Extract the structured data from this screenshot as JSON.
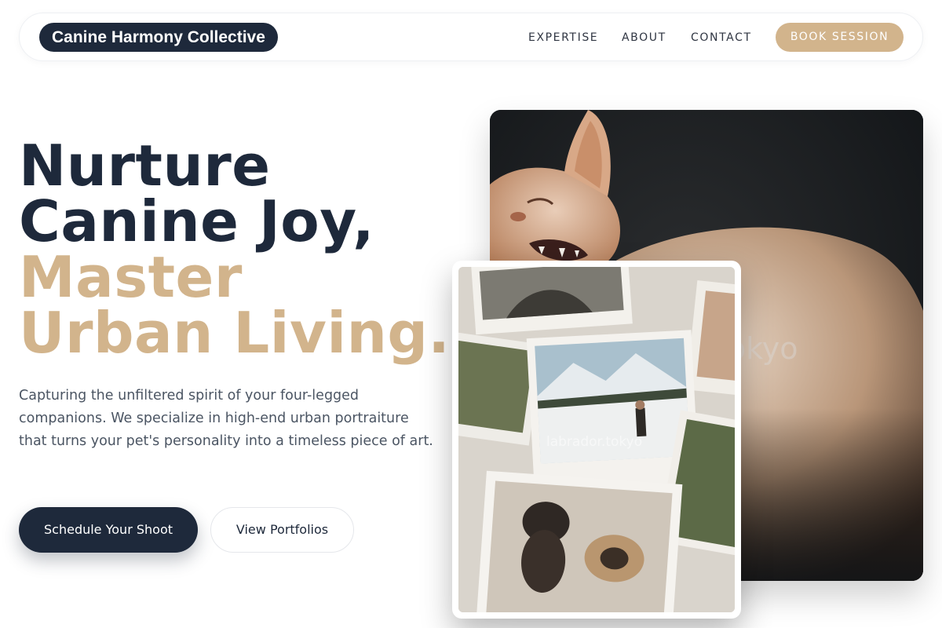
{
  "brand": {
    "name": "Canine Harmony Collective"
  },
  "nav": {
    "links": [
      "EXPERTISE",
      "ABOUT",
      "CONTACT"
    ],
    "cta_label": "BOOK SESSION"
  },
  "hero": {
    "headline_lines": [
      "Nurture",
      "Canine Joy,",
      "Master",
      "Urban Living."
    ],
    "lead": "Capturing the unfiltered spirit of your four-legged companions. We specialize in high-end urban portraiture that turns your pet's personality into a timeless piece of art.",
    "primary_cta": "Schedule Your Shoot",
    "secondary_cta": "View Portfolios"
  },
  "images": {
    "main_watermark": "tokyo",
    "inset_watermark": "labrador.tokyo"
  },
  "colors": {
    "navy": "#1e293b",
    "tan": "#d2b48c",
    "body_text": "#4b5563"
  }
}
